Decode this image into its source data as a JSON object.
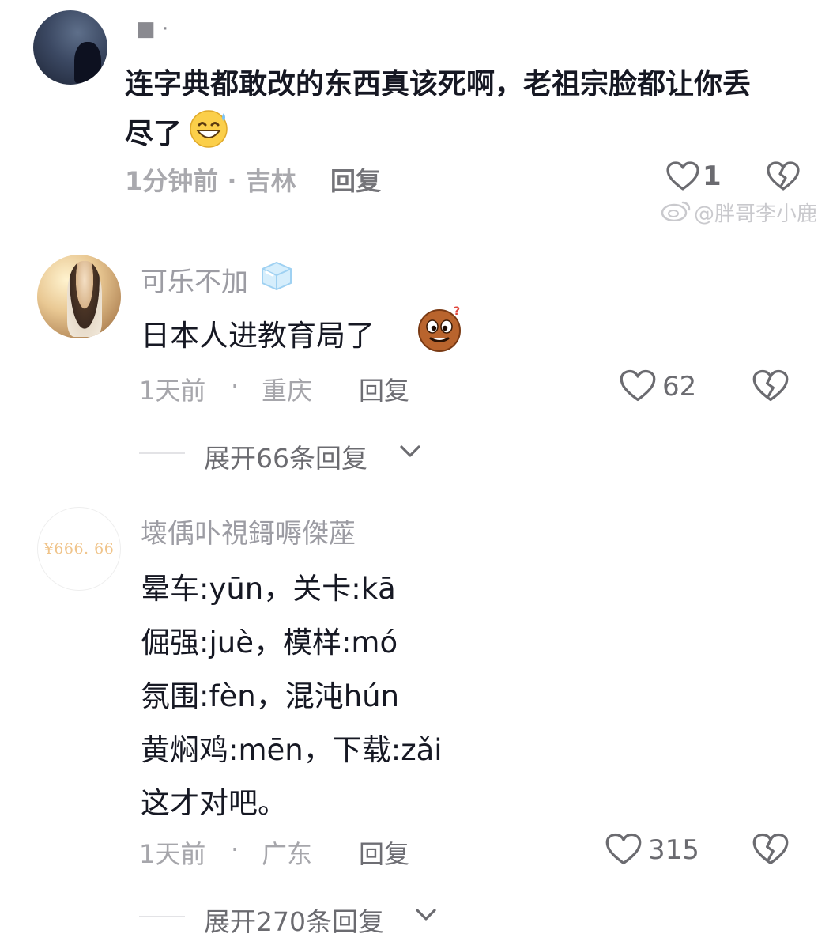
{
  "comments": [
    {
      "username": "■ ·",
      "text_line1": "连字典都敢改的东西真该死啊，老祖宗脸都让你丢",
      "text_line2": "尽了",
      "time": "1分钟前 · 吉林",
      "reply_label": "回复",
      "likes": "1",
      "emoji": "grinning-sweat-emoji"
    },
    {
      "username": "可乐不加",
      "text": "日本人进教育局了",
      "time": "1天前",
      "location": "重庆",
      "reply_label": "回复",
      "likes": "62",
      "expand_label": "展开66条回复",
      "emoji": "confused-cookie-emoji"
    },
    {
      "username": "壊偊卟視鎶嗕傑蓙",
      "avatar_text": "¥666. 66",
      "lines": [
        "晕车:yūn，关卡:kā",
        "倔强:juè，模样:mó",
        "氛围:fèn，混沌hún",
        "黄焖鸡:mēn，下载:zǎi",
        "这才对吧。"
      ],
      "time": "1天前",
      "location": "广东",
      "reply_label": "回复",
      "likes": "315",
      "expand_label": "展开270条回复"
    }
  ],
  "watermark": "@胖哥李小鹿",
  "separator": "·"
}
